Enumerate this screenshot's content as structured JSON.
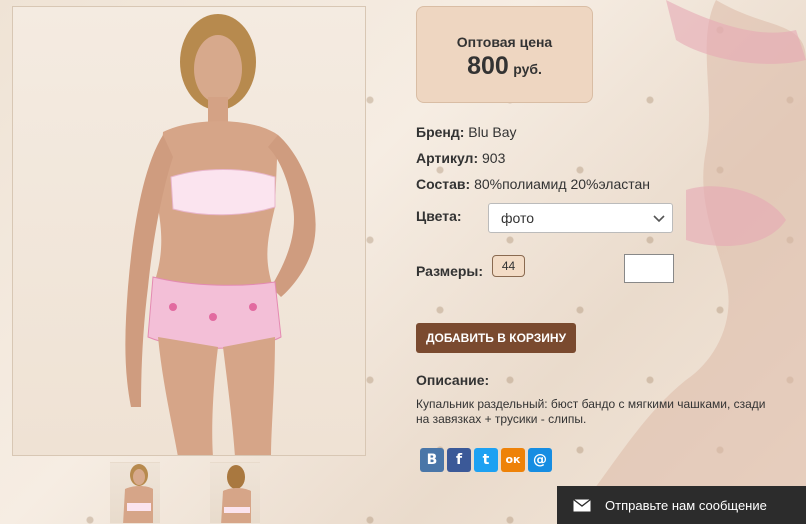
{
  "price": {
    "label": "Оптовая цена",
    "value": "800",
    "unit": "руб."
  },
  "attributes": {
    "brand_label": "Бренд:",
    "brand_value": "Blu Bay",
    "article_label": "Артикул:",
    "article_value": "903",
    "composition_label": "Состав:",
    "composition_value": "80%полиамид 20%эластан",
    "colors_label": "Цвета:",
    "colors_selected": "фото",
    "sizes_label": "Размеры:",
    "sizes": [
      "44"
    ]
  },
  "actions": {
    "add_to_cart": "ДОБАВИТЬ В КОРЗИНУ"
  },
  "description": {
    "title": "Описание:",
    "text": "Купальник раздельный: бюст бандо с мягкими чашками, сзади на завязках + трусики - слипы."
  },
  "social": [
    {
      "icon": "vk-icon",
      "glyph": "В",
      "color": "#4a76a8"
    },
    {
      "icon": "facebook-icon",
      "glyph": "f",
      "color": "#3b5998"
    },
    {
      "icon": "twitter-icon",
      "glyph": "t",
      "color": "#1da1f2"
    },
    {
      "icon": "odnoklassniki-icon",
      "glyph": "ок",
      "color": "#ee8208"
    },
    {
      "icon": "mail-icon",
      "glyph": "@",
      "color": "#168de2"
    }
  ],
  "chat": {
    "label": "Отправьте нам сообщение",
    "icon": "envelope-icon"
  },
  "colors": {
    "accent_button": "#7a4a2f",
    "price_box": "#eed6c1",
    "chat_bar": "#2c2c2c"
  }
}
